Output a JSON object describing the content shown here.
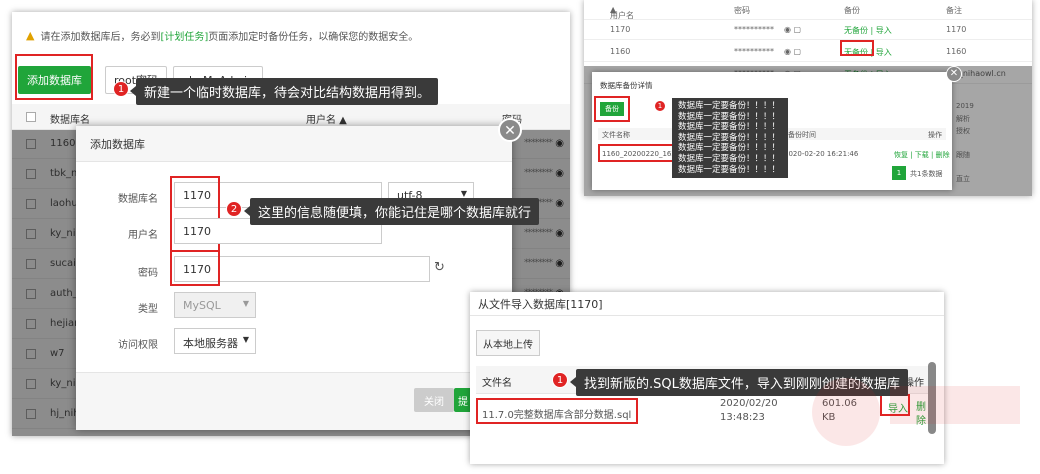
{
  "panel1": {
    "warning_text": "请在添加数据库后，务必到",
    "warning_link": "[计划任务]",
    "warning_text2": "页面添加定时备份任务，以确保您的数据安全。",
    "tabs": {
      "add_db": "添加数据库",
      "root_pwd": "root密码",
      "phpmyadmin": "phpMyAdmin"
    },
    "table_headers": {
      "name": "数据库名",
      "user": "用户名",
      "password": "密码"
    },
    "rows": [
      {
        "name": "1160",
        "user": ""
      },
      {
        "name": "tbk_n",
        "user": ""
      },
      {
        "name": "laohu",
        "user": ""
      },
      {
        "name": "ky_nih",
        "user": ""
      },
      {
        "name": "sucai",
        "user": ""
      },
      {
        "name": "auth_",
        "user": ""
      },
      {
        "name": "hejian",
        "user": ""
      },
      {
        "name": "w7",
        "user": ""
      },
      {
        "name": "ky_nih",
        "user": ""
      },
      {
        "name": "hj_nihaowl_cn",
        "user": "hj_nihaowl_cn"
      }
    ],
    "password_mask": "********"
  },
  "modal": {
    "title": "添加数据库",
    "labels": {
      "db_name": "数据库名",
      "username": "用户名",
      "password": "密码",
      "type": "类型",
      "access": "访问权限"
    },
    "values": {
      "db_name": "1170",
      "username": "1170",
      "password": "1170",
      "charset": "utf-8",
      "type": "MySQL",
      "access": "本地服务器"
    },
    "buttons": {
      "close": "关闭",
      "submit": "提"
    }
  },
  "tips": {
    "tip1_num": "1",
    "tip1": "新建一个临时数据库，待会对比结构数据用得到。",
    "tip2_num": "2",
    "tip2": "这里的信息随便填，你能记住是哪个数据库就行",
    "tip3_num": "1",
    "tip3": "找到新版的.SQL数据库文件，导入到刚刚创建的数据库"
  },
  "panel2": {
    "headers": {
      "user": "用户名",
      "password": "密码",
      "backup": "备份",
      "note": "备注"
    },
    "rows": [
      {
        "user": "1170",
        "pwd": "**********",
        "backup": "无备份 | 导入",
        "note": "1170"
      },
      {
        "user": "1160",
        "pwd": "**********",
        "backup": "无备份 | 导入",
        "note": "1160"
      },
      {
        "user": "",
        "pwd": "**********",
        "backup": "无备份 | 导入",
        "note": "tbk_nihaowl.cn"
      }
    ],
    "side_notes": [
      "2019",
      "解析",
      "授权",
      "",
      "跟随",
      "",
      "直立"
    ],
    "modal_title": "数据库备份详情",
    "backup_btn": "备份",
    "col_filename": "文件名称",
    "col_time": "备份时间",
    "col_op": "操作",
    "file_name": "1160_20200220_16214",
    "file_time": "2020-02-20 16:21:46",
    "file_ops": "恢复 | 下载 | 删除",
    "page_num": "1",
    "page_total": "共1条数据",
    "tip_lines": [
      "数据库一定要备份！！！！",
      "数据库一定要备份！！！！",
      "数据库一定要备份！！！！",
      "数据库一定要备份！！！！",
      "数据库一定要备份！！！！",
      "数据库一定要备份！！！！",
      "数据库一定要备份！！！！"
    ],
    "tip_num": "1"
  },
  "panel3": {
    "title": "从文件导入数据库[1170]",
    "upload_btn": "从本地上传",
    "col_filename": "文件名",
    "col_op": "操作",
    "file_name": "11.7.0完整数据库含部分数据.sql",
    "file_date": "2020/02/20",
    "file_time": "13:48:23",
    "file_size": "601.06",
    "file_unit": "KB",
    "import": "导入",
    "delete1": "删",
    "delete2": "除"
  },
  "colors": {
    "green": "#20a53a",
    "red": "#e02424",
    "tip_bg": "#3a3a3a"
  }
}
